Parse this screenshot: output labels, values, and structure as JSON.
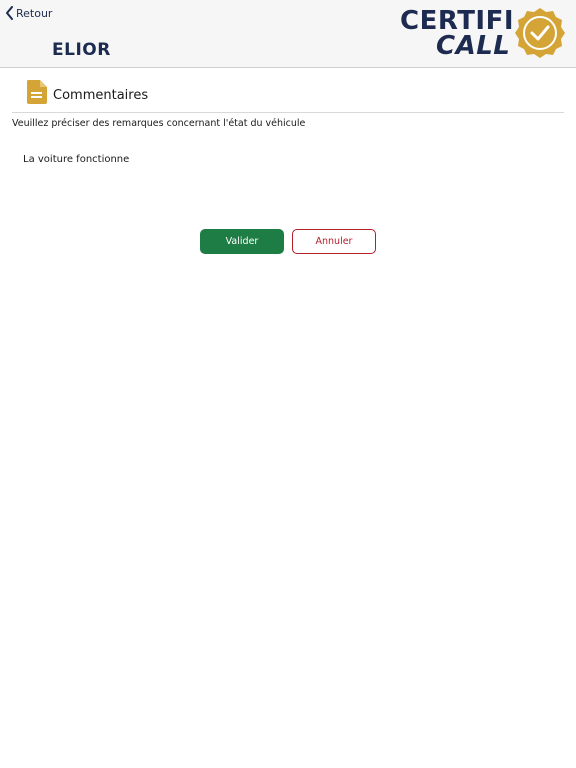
{
  "header": {
    "back_label": "Retour",
    "company_name": "ELIOR",
    "brand": {
      "line1": "CERTIFI",
      "line2": "CALL"
    }
  },
  "section": {
    "icon": "document-icon",
    "title": "Commentaires"
  },
  "form": {
    "prompt": "Veuillez préciser des remarques concernant l'état du véhicule",
    "comment_value": "La voiture fonctionne"
  },
  "actions": {
    "validate_label": "Valider",
    "cancel_label": "Annuler"
  },
  "colors": {
    "brand_navy": "#1c2b4f",
    "gold": "#d4a437",
    "validate_green": "#1e7d45",
    "cancel_red": "#b3202a"
  }
}
